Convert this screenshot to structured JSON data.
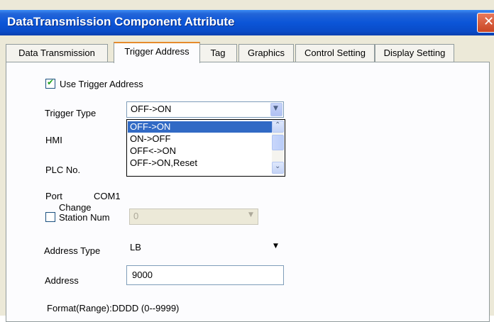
{
  "window": {
    "title": "DataTransmission Component Attribute",
    "close_glyph": "✕"
  },
  "tabs": [
    {
      "label": "Data Transmission"
    },
    {
      "label": "Trigger Address"
    },
    {
      "label": "Tag"
    },
    {
      "label": "Graphics"
    },
    {
      "label": "Control Setting"
    },
    {
      "label": "Display Setting"
    }
  ],
  "active_tab": "Trigger Address",
  "use_trigger": {
    "label": "Use Trigger Address",
    "checked": true
  },
  "trigger_type": {
    "label": "Trigger Type",
    "value": "OFF->ON",
    "options": [
      "OFF->ON",
      "ON->OFF",
      "OFF<->ON",
      "OFF->ON,Reset"
    ],
    "selected_index": 0
  },
  "hmi": {
    "label": "HMI"
  },
  "plc_no": {
    "label": "PLC No."
  },
  "port": {
    "label": "Port",
    "value": "COM1"
  },
  "change_station": {
    "label_line1": "Change",
    "label_line2": "Station Num",
    "checked": false,
    "value": "0"
  },
  "address_type": {
    "label": "Address Type",
    "value": "LB"
  },
  "address": {
    "label": "Address",
    "value": "9000"
  },
  "format": {
    "text": "Format(Range):DDDD (0--9999)"
  },
  "icons": {
    "dropdown_arrow": "▼",
    "scroll_up": "⌃",
    "scroll_down": "⌄",
    "check": "✔"
  },
  "colors": {
    "title_bar": "#0a4bc7",
    "selection": "#316ac5",
    "active_tab_accent": "#e68b2c"
  }
}
